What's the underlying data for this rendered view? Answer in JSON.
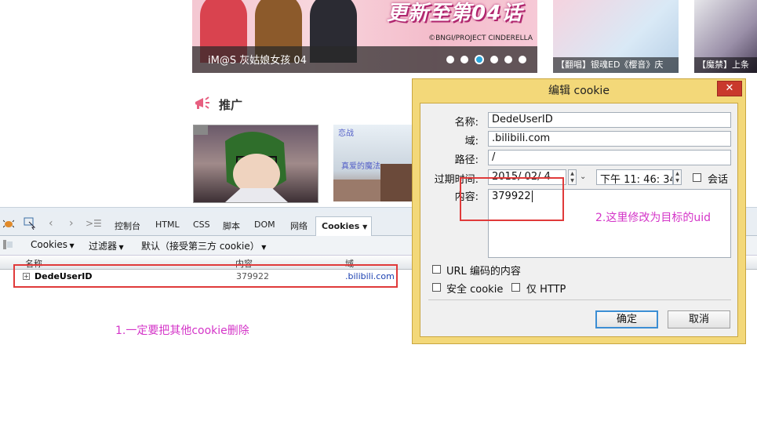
{
  "banner": {
    "title_art": "更新至第04话",
    "copyright": "©BNGI/PROJECT CINDERELLA",
    "caption": "iM@S 灰姑娘女孩 04",
    "slide_count": 6,
    "active_slide": 3
  },
  "thumbs": [
    {
      "caption": "【翻唱】银魂ED《樱音》庆"
    },
    {
      "caption": "【魔禁】上条"
    }
  ],
  "promo": {
    "title": "推广",
    "icon": "megaphone-icon"
  },
  "firebug": {
    "tabs": [
      "控制台",
      "HTML",
      "CSS",
      "脚本",
      "DOM",
      "网络"
    ],
    "active_tab": "Cookies",
    "toolbar": {
      "cookies_menu": "Cookies",
      "filter_menu": "过滤器",
      "default_menu": "默认（接受第三方 cookie）"
    },
    "columns": {
      "name": "名称",
      "content": "内容",
      "domain": "域"
    },
    "rows": [
      {
        "name": "DedeUserID",
        "content": "379922",
        "domain": ".bilibili.com"
      }
    ]
  },
  "dialog": {
    "title": "编辑 cookie",
    "labels": {
      "name": "名称:",
      "domain": "域:",
      "path": "路径:",
      "expires": "过期时间:",
      "content": "内容:"
    },
    "values": {
      "name": "DedeUserID",
      "domain": ".bilibili.com",
      "path": "/",
      "date": "2015/ 02/   4",
      "time": "下午 11: 46: 34",
      "content": "379922"
    },
    "checkboxes": {
      "session": "会话",
      "url_encoded": "URL 编码的内容",
      "secure": "安全 cookie",
      "http_only": "仅 HTTP"
    },
    "buttons": {
      "ok": "确定",
      "cancel": "取消"
    }
  },
  "annotations": {
    "step1": "1.一定要把其他cookie删除",
    "step2": "2.这里修改为目标的uid"
  },
  "colors": {
    "annotation": "#d435c8",
    "highlight_box": "#e03a3a",
    "dialog_frame": "#f3d879",
    "active_dot": "#2ba6db"
  }
}
